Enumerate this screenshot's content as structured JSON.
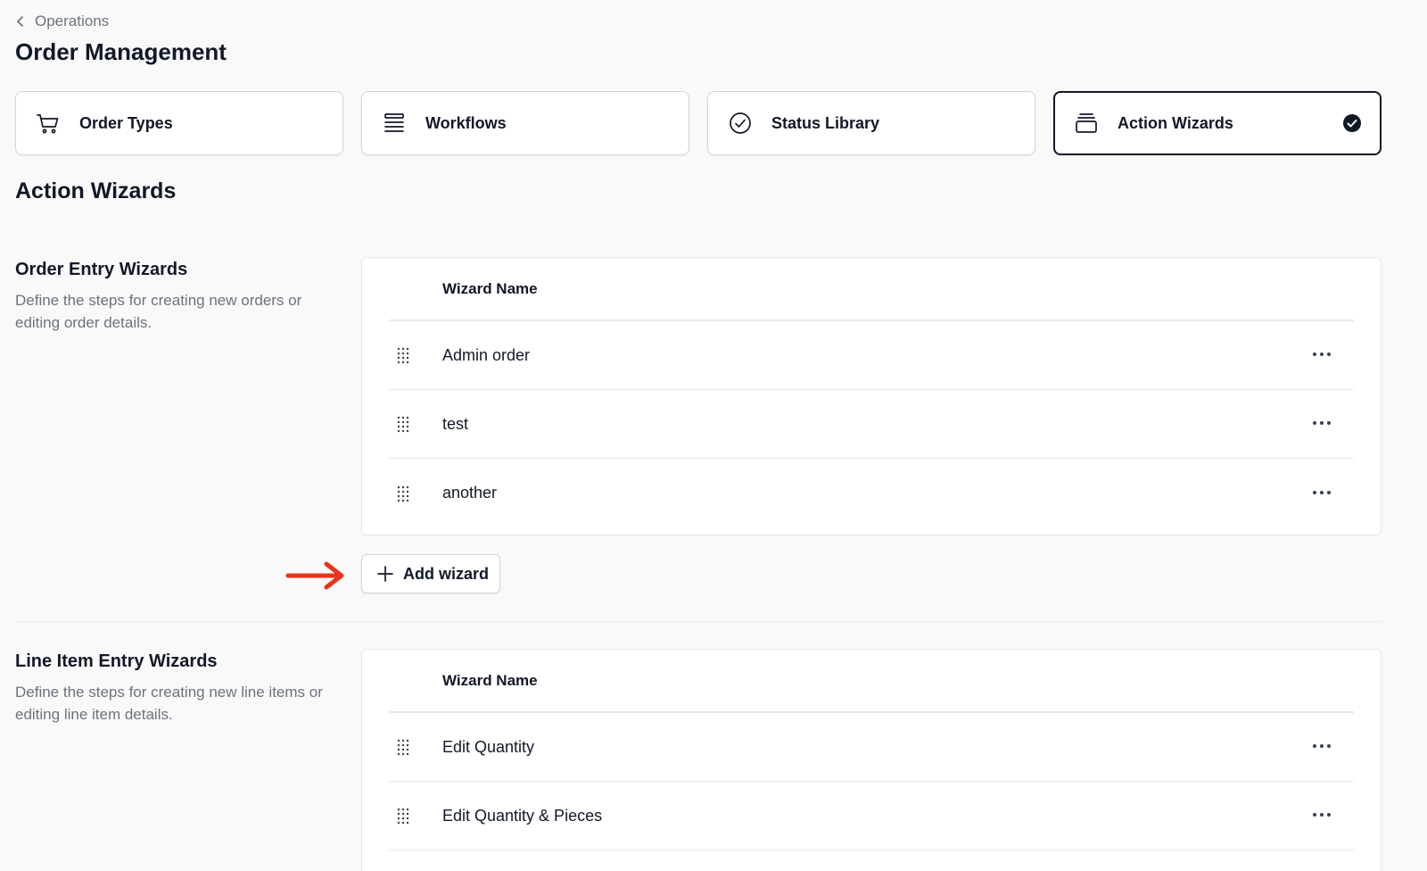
{
  "breadcrumb": {
    "label": "Operations",
    "icon": "chevron-left-icon"
  },
  "page": {
    "title": "Order Management"
  },
  "tabs": [
    {
      "label": "Order Types",
      "icon": "cart-icon",
      "active": false
    },
    {
      "label": "Workflows",
      "icon": "stacked-lines-icon",
      "active": false
    },
    {
      "label": "Status Library",
      "icon": "check-circle-icon",
      "active": false
    },
    {
      "label": "Action Wizards",
      "icon": "archive-box-icon",
      "active": true
    }
  ],
  "section": {
    "title": "Action Wizards"
  },
  "order_entry": {
    "title": "Order Entry Wizards",
    "description": "Define the steps for creating new orders or editing order details.",
    "column_header": "Wizard Name",
    "rows": [
      {
        "name": "Admin order"
      },
      {
        "name": "test"
      },
      {
        "name": "another"
      }
    ],
    "add_label": "Add wizard"
  },
  "line_item_entry": {
    "title": "Line Item Entry Wizards",
    "description": "Define the steps for creating new line items or editing line item details.",
    "column_header": "Wizard Name",
    "rows": [
      {
        "name": "Edit Quantity"
      },
      {
        "name": "Edit Quantity & Pieces"
      }
    ]
  },
  "colors": {
    "accent": "#111827",
    "annotation_arrow": "#e8341c",
    "muted_text": "#6b7280",
    "border": "#e5e7eb"
  }
}
